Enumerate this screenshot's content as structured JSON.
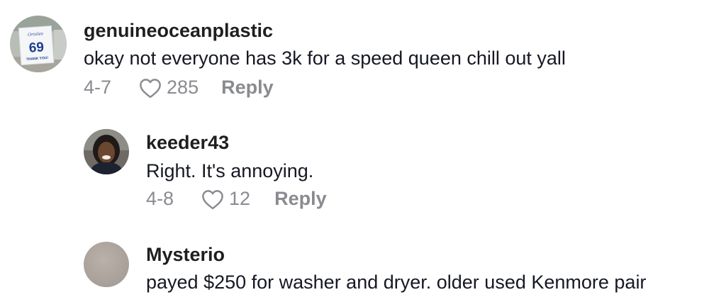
{
  "colors": {
    "text": "#161823",
    "muted": "#8a8b91",
    "username": "#1f1f1f"
  },
  "comments": [
    {
      "username": "genuineoceanplastic",
      "text": "okay not everyone has 3k for a speed queen chill out yall",
      "date": "4-7",
      "likes": "285",
      "reply_label": "Reply",
      "avatar": {
        "sign_script": "Orioles",
        "sign_number": "69",
        "sign_footer": "THANK YOU!"
      }
    },
    {
      "username": "keeder43",
      "text": "Right. It's annoying.",
      "date": "4-8",
      "likes": "12",
      "reply_label": "Reply"
    },
    {
      "username": "Mysterio",
      "text": "payed $250 for washer and dryer. older used Kenmore pair"
    }
  ],
  "icons": {
    "like": "heart-outline-icon"
  }
}
